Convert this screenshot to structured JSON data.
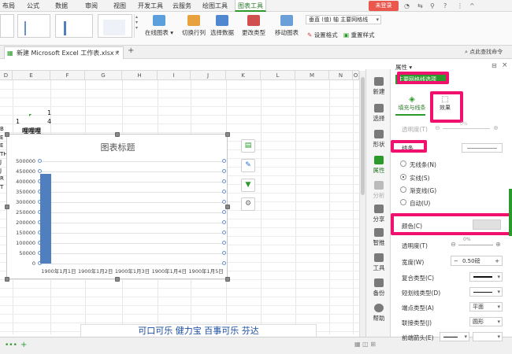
{
  "menubar": {
    "tabs": [
      "布局",
      "公式",
      "数据",
      "审阅",
      "视图",
      "开发工具",
      "云服务",
      "绘图工具",
      "图表工具"
    ],
    "active_tab": "图表工具",
    "login": "未登录"
  },
  "ribbon": {
    "online_chart": "在线图表",
    "switch_row_col": "切换行列",
    "select_data": "选择数据",
    "change_type": "更改类型",
    "move_chart": "移动图表",
    "axis_select": "垂直 (值) 轴 主要网格线",
    "set_format": "设置格式",
    "reset_style": "重置样式"
  },
  "tabbar": {
    "doc_title": "新建 Microsoft Excel 工作表.xlsx *",
    "search": "点此查找命令"
  },
  "sheet": {
    "columns": [
      "D",
      "E",
      "F",
      "G",
      "H",
      "I",
      "J",
      "K",
      "L",
      "M",
      "N",
      "O"
    ],
    "cells": {
      "e1": "1",
      "d2": "1",
      "e2": "4",
      "e3": "哩哩哩"
    },
    "left_letters": [
      "B",
      "E",
      "E",
      "TH",
      "J",
      "J",
      "R",
      "T"
    ]
  },
  "chart_data": {
    "type": "bar",
    "title": "图表标题",
    "categories": [
      "1900年1月1日",
      "1900年1月2日",
      "1900年1月3日",
      "1900年1月4日",
      "1900年1月5日"
    ],
    "values": [
      440000,
      0,
      0,
      0,
      0
    ],
    "ylim": [
      0,
      500000
    ],
    "yticks": [
      "500000",
      "450000",
      "400000",
      "350000",
      "300000",
      "250000",
      "200000",
      "150000",
      "100000",
      "50000",
      "0"
    ],
    "grid": true,
    "bar_color": "#4f7fbf"
  },
  "panel": {
    "header": "属性",
    "dropdown": "主要网格线选项",
    "tab_fill": "填充与线条",
    "tab_effect": "效果",
    "transparency1": "透明度(T)",
    "pct1": "0%",
    "line_section": "线条",
    "no_line": "无线条(N)",
    "solid_line": "实线(S)",
    "gradient_line": "渐变线(G)",
    "auto": "自动(U)",
    "color": "颜色(C)",
    "transparency2": "透明度(T)",
    "pct2": "0%",
    "width": "宽度(W)",
    "width_value": "0.50磅",
    "compound": "复合类型(C)",
    "dash": "短划线类型(D)",
    "cap": "端点类型(A)",
    "cap_value": "平面",
    "join": "联接类型(J)",
    "join_value": "圆形",
    "arrow": "前端箭头(E)"
  },
  "sidebar": [
    "新建",
    "选择",
    "形状",
    "属性",
    "分析",
    "分享",
    "智推",
    "工具",
    "备份",
    "帮助"
  ],
  "bottom": {
    "text": "可口可乐 健力宝 百事可乐 芬达"
  },
  "colors": {
    "accent_green": "#2a9b2a",
    "highlight_pink": "#f0106e",
    "login_red": "#e9574d"
  }
}
